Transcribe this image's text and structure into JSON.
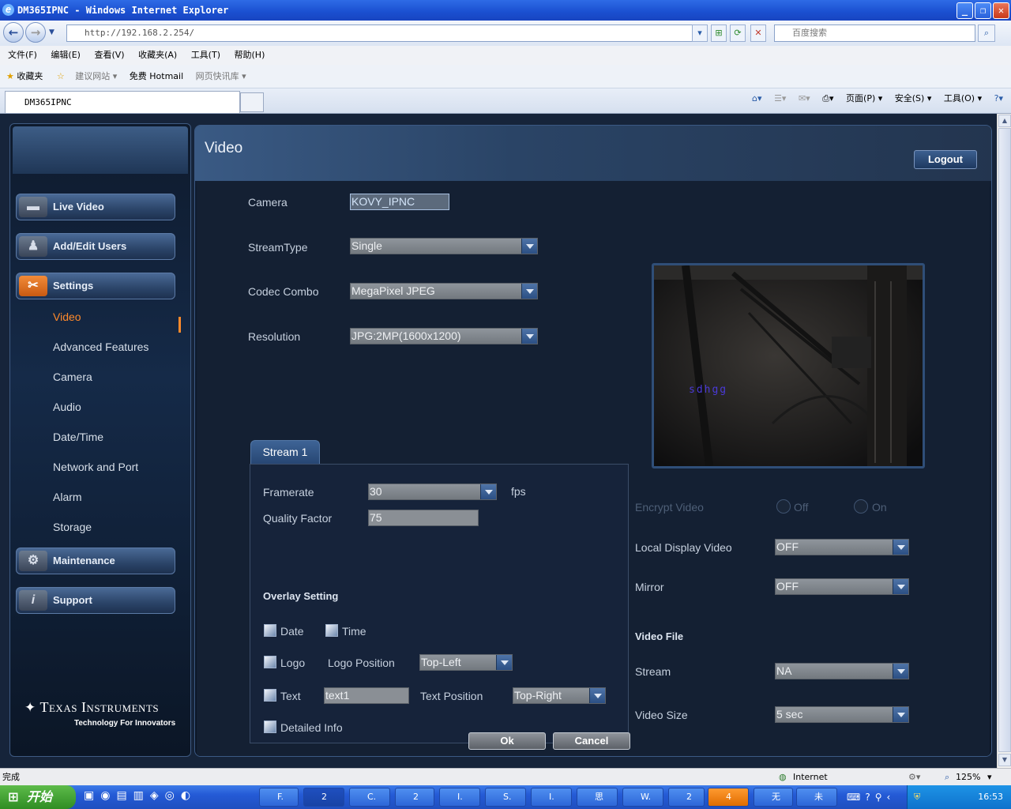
{
  "window": {
    "title": "DM365IPNC - Windows Internet Explorer"
  },
  "browser": {
    "address": "http://192.168.2.254/",
    "search_placeholder": "百度搜索",
    "menu": [
      "文件(F)",
      "编辑(E)",
      "查看(V)",
      "收藏夹(A)",
      "工具(T)",
      "帮助(H)"
    ],
    "favorites_label": "收藏夹",
    "fav_links": [
      "建议网站 ▾",
      "免费 Hotmail",
      "网页快讯库 ▾"
    ],
    "tab_title": "DM365IPNC",
    "toolbar_right": [
      "页面(P) ▾",
      "安全(S) ▾",
      "工具(O) ▾"
    ]
  },
  "sidebar": {
    "menu": [
      {
        "label": "Live Video",
        "icon": "video-camera-icon"
      },
      {
        "label": "Add/Edit Users",
        "icon": "users-icon"
      },
      {
        "label": "Settings",
        "icon": "tools-icon"
      },
      {
        "label": "Maintenance",
        "icon": "wrench-icon"
      },
      {
        "label": "Support",
        "icon": "info-icon"
      }
    ],
    "settings_submenu": [
      "Video",
      "Advanced Features",
      "Camera",
      "Audio",
      "Date/Time",
      "Network and Port",
      "Alarm",
      "Storage"
    ],
    "active_submenu": "Video",
    "logo_text": "Texas Instruments",
    "logo_tagline": "Technology For Innovators"
  },
  "content": {
    "title": "Video",
    "logout_label": "Logout",
    "camera_label": "Camera",
    "camera_value": "KOVY_IPNC",
    "streamtype_label": "StreamType",
    "streamtype_value": "Single",
    "codec_label": "Codec Combo",
    "codec_value": "MegaPixel JPEG",
    "resolution_label": "Resolution",
    "resolution_value": "JPG:2MP(1600x1200)",
    "stream_tab": "Stream 1",
    "framerate_label": "Framerate",
    "framerate_value": "30",
    "fps_unit": "fps",
    "quality_label": "Quality Factor",
    "quality_value": "75",
    "overlay_heading": "Overlay Setting",
    "overlay": {
      "date_label": "Date",
      "time_label": "Time",
      "logo_label": "Logo",
      "logo_position_label": "Logo Position",
      "logo_position_value": "Top-Left",
      "text_label": "Text",
      "text_value": "text1",
      "text_position_label": "Text Position",
      "text_position_value": "Top-Right",
      "detailed_label": "Detailed Info"
    },
    "preview_overlay_text": "sdhgg",
    "encrypt_label": "Encrypt Video",
    "encrypt_off": "Off",
    "encrypt_on": "On",
    "local_display_label": "Local Display Video",
    "local_display_value": "OFF",
    "mirror_label": "Mirror",
    "mirror_value": "OFF",
    "video_file_heading": "Video File",
    "stream_label": "Stream",
    "stream_value": "NA",
    "video_size_label": "Video Size",
    "video_size_value": "5 sec",
    "ok_label": "Ok",
    "cancel_label": "Cancel"
  },
  "status": {
    "left": "完成",
    "zone": "Internet",
    "zoom": "125%"
  },
  "taskbar": {
    "start_label": "开始",
    "items": [
      "F.",
      "2",
      "C.",
      "2",
      "I.",
      "S.",
      "I.",
      "思",
      "W.",
      "2",
      "4",
      "无",
      "未"
    ],
    "clock": "16:53"
  }
}
